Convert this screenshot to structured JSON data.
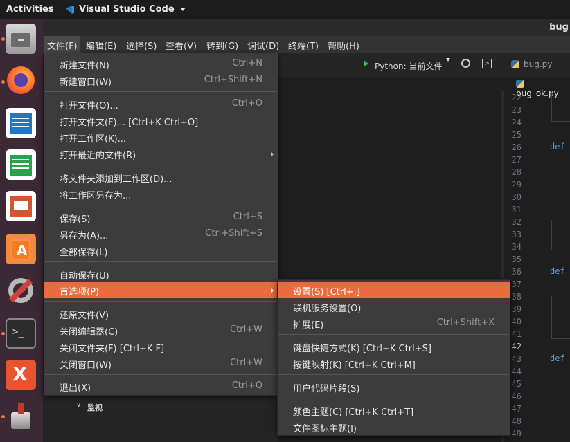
{
  "topbar": {
    "activities": "Activities",
    "app_name": "Visual Studio Code"
  },
  "window": {
    "title": "bug"
  },
  "menubar": [
    "文件(F)",
    "编辑(E)",
    "选择(S)",
    "查看(V)",
    "转到(G)",
    "调试(D)",
    "终端(T)",
    "帮助(H)"
  ],
  "toolbar": {
    "run_label": "Python: 当前文件",
    "tab1": "bug.py",
    "tab2": "bug_ok.py"
  },
  "editor": {
    "line_numbers": [
      "22",
      "23",
      "24",
      "25",
      "26",
      "27",
      "28",
      "29",
      "30",
      "31",
      "32",
      "33",
      "34",
      "35",
      "36",
      "37",
      "38",
      "39",
      "40",
      "41",
      "42",
      "43",
      "44",
      "45",
      "46",
      "47",
      "48",
      "49"
    ],
    "current_line": "42",
    "def_keyword": "def"
  },
  "panel": {
    "watch_label": "监视"
  },
  "file_menu": {
    "items": [
      {
        "label": "新建文件(N)",
        "shortcut": "Ctrl+N"
      },
      {
        "label": "新建窗口(W)",
        "shortcut": "Ctrl+Shift+N"
      },
      {
        "label": "打开文件(O)...",
        "shortcut": "Ctrl+O"
      },
      {
        "label": "打开文件夹(F)... [Ctrl+K Ctrl+O]",
        "shortcut": ""
      },
      {
        "label": "打开工作区(K)...",
        "shortcut": ""
      },
      {
        "label": "打开最近的文件(R)",
        "shortcut": ""
      },
      {
        "label": "将文件夹添加到工作区(D)...",
        "shortcut": ""
      },
      {
        "label": "将工作区另存为...",
        "shortcut": ""
      },
      {
        "label": "保存(S)",
        "shortcut": "Ctrl+S"
      },
      {
        "label": "另存为(A)...",
        "shortcut": "Ctrl+Shift+S"
      },
      {
        "label": "全部保存(L)",
        "shortcut": ""
      },
      {
        "label": "自动保存(U)",
        "shortcut": ""
      },
      {
        "label": "首选项(P)",
        "shortcut": ""
      },
      {
        "label": "还原文件(V)",
        "shortcut": ""
      },
      {
        "label": "关闭编辑器(C)",
        "shortcut": "Ctrl+W"
      },
      {
        "label": "关闭文件夹(F) [Ctrl+K F]",
        "shortcut": ""
      },
      {
        "label": "关闭窗口(W)",
        "shortcut": "Ctrl+W"
      },
      {
        "label": "退出(X)",
        "shortcut": "Ctrl+Q"
      }
    ]
  },
  "prefs_menu": {
    "items": [
      {
        "label": "设置(S) [Ctrl+,]",
        "shortcut": ""
      },
      {
        "label": "联机服务设置(O)",
        "shortcut": ""
      },
      {
        "label": "扩展(E)",
        "shortcut": "Ctrl+Shift+X"
      },
      {
        "label": "键盘快捷方式(K) [Ctrl+K Ctrl+S]",
        "shortcut": ""
      },
      {
        "label": "按键映射(K) [Ctrl+K Ctrl+M]",
        "shortcut": ""
      },
      {
        "label": "用户代码片段(S)",
        "shortcut": ""
      },
      {
        "label": "颜色主题(C) [Ctrl+K Ctrl+T]",
        "shortcut": ""
      },
      {
        "label": "文件图标主题(I)",
        "shortcut": ""
      }
    ]
  },
  "colors": {
    "highlight": "#ea6b3d",
    "dock": "#3b2a36"
  },
  "dock_icons": [
    "files-icon",
    "firefox-icon",
    "writer-icon",
    "calc-icon",
    "impress-icon",
    "software-center-icon",
    "settings-icon",
    "terminal-icon",
    "xmind-icon",
    "installer-icon"
  ]
}
